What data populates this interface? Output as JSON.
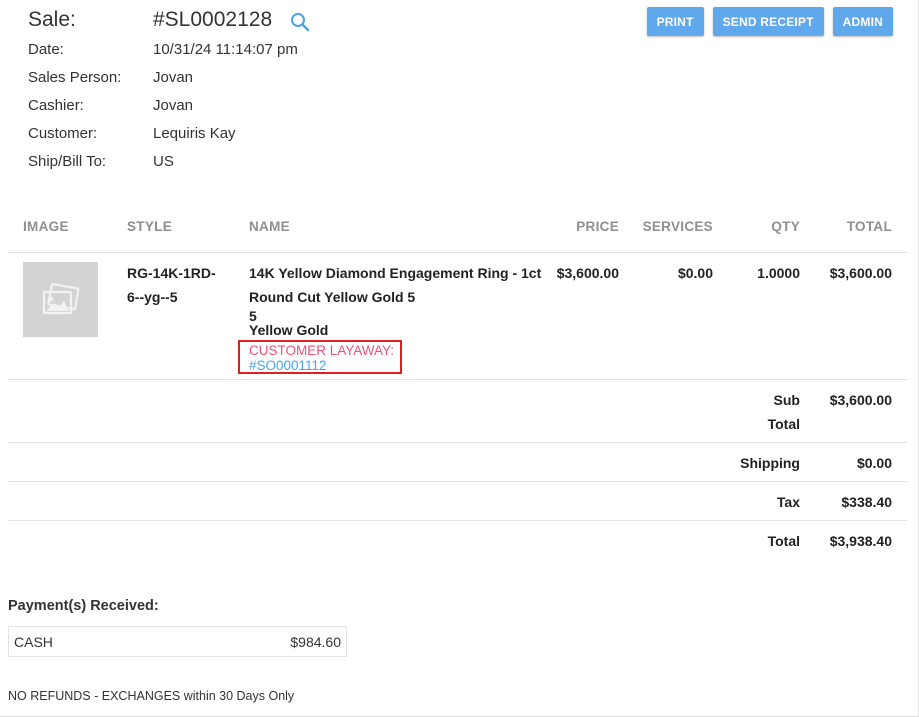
{
  "sale": {
    "label": "Sale:",
    "number": "#SL0002128",
    "date_label": "Date:",
    "date": "10/31/24 11:14:07 pm",
    "salesperson_label": "Sales Person:",
    "salesperson": "Jovan",
    "cashier_label": "Cashier:",
    "cashier": "Jovan",
    "customer_label": "Customer:",
    "customer": "Lequiris Kay",
    "ship_label": "Ship/Bill To:",
    "ship": "US"
  },
  "actions": {
    "print": "PRINT",
    "send_receipt": "SEND RECEIPT",
    "admin": "ADMIN"
  },
  "table": {
    "headers": {
      "image": "IMAGE",
      "style": "STYLE",
      "name": "NAME",
      "price": "PRICE",
      "services": "SERVICES",
      "qty": "QTY",
      "total": "TOTAL"
    },
    "item": {
      "style_line1": "RG-14K-1RD-",
      "style_line2": "6--yg--5",
      "name_line1": "14K Yellow Diamond Engagement Ring - 1ct",
      "name_line2": "Round Cut Yellow Gold 5",
      "attr_size": "5",
      "attr_metal": "Yellow Gold",
      "layaway_label": "CUSTOMER LAYAWAY:",
      "layaway_link": "#SO0001112",
      "price": "$3,600.00",
      "services": "$0.00",
      "qty": "1.0000",
      "total": "$3,600.00"
    }
  },
  "summary": {
    "subtotal_label_1": "Sub",
    "subtotal_label_2": "Total",
    "subtotal": "$3,600.00",
    "shipping_label": "Shipping",
    "shipping": "$0.00",
    "tax_label": "Tax",
    "tax": "$338.40",
    "total_label": "Total",
    "total": "$3,938.40"
  },
  "payments": {
    "title": "Payment(s) Received:",
    "method": "CASH",
    "amount": "$984.60"
  },
  "footer_note": "NO REFUNDS - EXCHANGES within 30 Days Only",
  "icons": {
    "search": "search-icon",
    "placeholder": "image-placeholder-icon"
  },
  "colors": {
    "accent": "#5fa8ec",
    "link": "#4aa3e8",
    "layaway": "#e8527a",
    "highlight_border": "#e02020"
  }
}
